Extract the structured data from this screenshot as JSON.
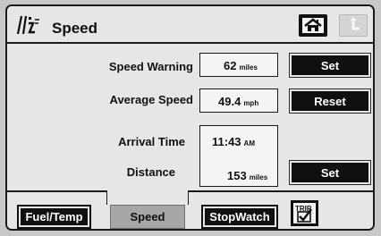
{
  "header": {
    "title": "Speed",
    "home_icon": "home-icon",
    "back_icon": "back-arrow-icon",
    "logo_icon": "trip-computer-logo-icon"
  },
  "rows": {
    "speed_warning": {
      "label": "Speed Warning",
      "value": "62",
      "unit": "miles",
      "button": "Set"
    },
    "average_speed": {
      "label": "Average Speed",
      "value": "49.4",
      "unit": "mph",
      "button": "Reset"
    },
    "arrival_time": {
      "label": "Arrival Time",
      "value": "11:43",
      "unit": "AM"
    },
    "distance": {
      "label": "Distance",
      "value": "153",
      "unit": "miles",
      "button": "Set"
    }
  },
  "tabs": [
    {
      "label": "Fuel/Temp",
      "selected": false
    },
    {
      "label": "Speed",
      "selected": true
    },
    {
      "label": "StopWatch",
      "selected": false
    },
    {
      "label": "",
      "icon": "trip-checklist-icon",
      "icon_text": "TRIP",
      "selected": false
    }
  ]
}
